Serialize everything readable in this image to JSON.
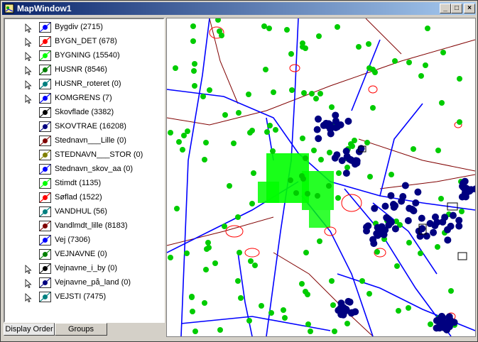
{
  "window": {
    "title": "MapWindow1",
    "buttons": {
      "minimize": "_",
      "maximize": "□",
      "close": "×"
    }
  },
  "legend": {
    "layers": [
      {
        "label": "Bygdiv (2715)",
        "pointer": true,
        "color": "#0000ff",
        "kind": "dot"
      },
      {
        "label": "BYGN_DET (678)",
        "pointer": true,
        "color": "#ff0000",
        "kind": "line"
      },
      {
        "label": "BYGNING (15540)",
        "pointer": true,
        "color": "#00ff00",
        "kind": "line"
      },
      {
        "label": "HUSNR (8546)",
        "pointer": true,
        "color": "#008000",
        "kind": "line"
      },
      {
        "label": "HUSNR_roteret (0)",
        "pointer": true,
        "color": "#008080",
        "kind": "line"
      },
      {
        "label": "KOMGRENS (7)",
        "pointer": true,
        "color": "#0000ff",
        "kind": "line"
      },
      {
        "label": "Skovflade (3382)",
        "pointer": false,
        "color": "#000000",
        "kind": "dot"
      },
      {
        "label": "SKOVTRAE (16208)",
        "pointer": false,
        "color": "#000080",
        "kind": "dot"
      },
      {
        "label": "Stednavn___Lille (0)",
        "pointer": false,
        "color": "#800000",
        "kind": "dot"
      },
      {
        "label": "STEDNAVN___STOR (0)",
        "pointer": false,
        "color": "#808000",
        "kind": "dot"
      },
      {
        "label": "Stednavn_skov_aa (0)",
        "pointer": false,
        "color": "#0000ff",
        "kind": "dot"
      },
      {
        "label": "Stimdt (1135)",
        "pointer": false,
        "color": "#00ff00",
        "kind": "dot"
      },
      {
        "label": "Søflad (1522)",
        "pointer": false,
        "color": "#ff0000",
        "kind": "line"
      },
      {
        "label": "VANDHUL (56)",
        "pointer": false,
        "color": "#008080",
        "kind": "line"
      },
      {
        "label": "Vandlmdt_lille (8183)",
        "pointer": false,
        "color": "#800000",
        "kind": "dot"
      },
      {
        "label": "Vej (7306)",
        "pointer": false,
        "color": "#0000ff",
        "kind": "line"
      },
      {
        "label": "VEJNAVNE (0)",
        "pointer": false,
        "color": "#008000",
        "kind": "dot"
      },
      {
        "label": "Vejnavne_i_by (0)",
        "pointer": true,
        "color": "#000000",
        "kind": "dot"
      },
      {
        "label": "Vejnavne_på_land (0)",
        "pointer": true,
        "color": "#000080",
        "kind": "dot"
      },
      {
        "label": "VEJSTI (7475)",
        "pointer": true,
        "color": "#008080",
        "kind": "line"
      }
    ]
  },
  "tabs": [
    {
      "label": "Display Order",
      "active": true
    },
    {
      "label": "Groups",
      "active": false
    }
  ],
  "map": {
    "colors": {
      "roads": "#0000ff",
      "trees": "#00cc00",
      "forest": "#000080",
      "buildings": "#00ff00",
      "boundaries": "#800000",
      "lakes": "#ff0000"
    }
  }
}
